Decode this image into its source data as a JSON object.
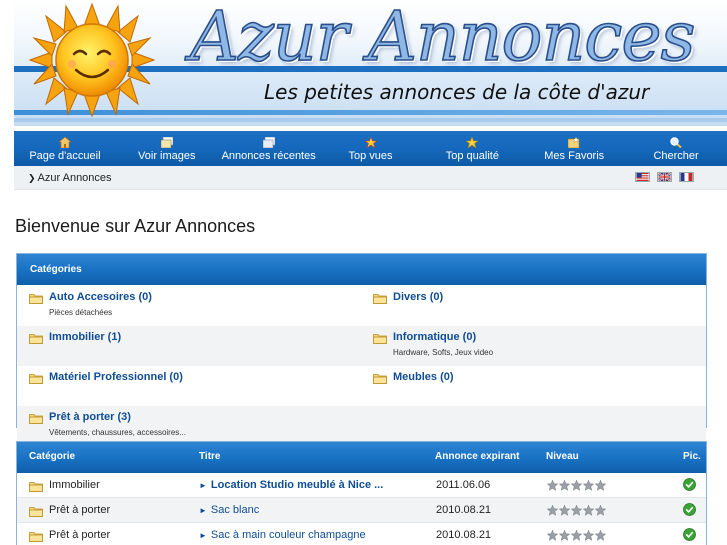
{
  "header": {
    "title": "Azur Annonces",
    "subtitle": "Les petites annonces de la côte d'azur"
  },
  "nav": [
    {
      "label": "Page d'accueil",
      "icon": "home-icon"
    },
    {
      "label": "Voir images",
      "icon": "images-icon"
    },
    {
      "label": "Annonces récentes",
      "icon": "recent-icon"
    },
    {
      "label": "Top vues",
      "icon": "top-views-icon"
    },
    {
      "label": "Top qualité",
      "icon": "star-icon"
    },
    {
      "label": "Mes Favoris",
      "icon": "favorites-icon"
    },
    {
      "label": "Chercher",
      "icon": "search-icon"
    }
  ],
  "breadcrumb": {
    "label": "Azur Annonces"
  },
  "flags": [
    "flag-us-icon",
    "flag-uk-icon",
    "flag-fr-icon"
  ],
  "page": {
    "title": "Bienvenue sur Azur Annonces"
  },
  "categories": {
    "header": "Catégories",
    "rows": [
      {
        "left": {
          "name": "Auto Accesoires (0)",
          "desc": "Pièces détachées"
        },
        "right": {
          "name": "Divers (0)",
          "desc": ""
        }
      },
      {
        "left": {
          "name": "Immobilier (1)",
          "desc": ""
        },
        "right": {
          "name": "Informatique (0)",
          "desc": "Hardware, Softs, Jeux video"
        }
      },
      {
        "left": {
          "name": "Matériel Professionnel (0)",
          "desc": ""
        },
        "right": {
          "name": "Meubles (0)",
          "desc": ""
        }
      },
      {
        "left": {
          "name": "Prêt à porter (3)",
          "desc": "Vêtements, chaussures, accessoires..."
        },
        "right": null
      }
    ]
  },
  "listings": {
    "headers": {
      "category": "Catégorie",
      "title": "Titre",
      "expiry": "Annonce expirant",
      "level": "Niveau",
      "pic": "Pic."
    },
    "rows": [
      {
        "category": "Immobilier",
        "title": "Location Studio meublé à Nice ...",
        "bold": true,
        "expiry": "2011.06.06",
        "level": 5,
        "pic": true
      },
      {
        "category": "Prêt à porter",
        "title": "Sac blanc",
        "bold": false,
        "expiry": "2010.08.21",
        "level": 5,
        "pic": true
      },
      {
        "category": "Prêt à porter",
        "title": "Sac à main couleur champagne",
        "bold": false,
        "expiry": "2010.08.21",
        "level": 5,
        "pic": true
      }
    ]
  },
  "colors": {
    "nav_blue": "#1568bb",
    "link_blue": "#0f4d94",
    "header_blue": "#1a72c4",
    "check_green": "#3aa236"
  }
}
